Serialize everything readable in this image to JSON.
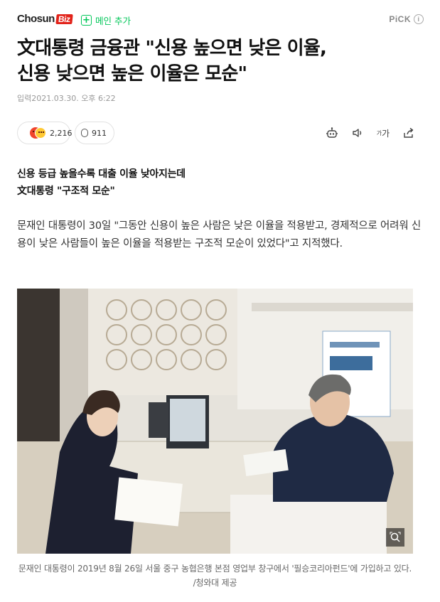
{
  "header": {
    "logo_text": "Chosun",
    "logo_badge": "Biz",
    "add_main_label": "메인 추가",
    "pick_label": "PiCK",
    "info_symbol": "i"
  },
  "article": {
    "title_line1": "文대통령 금융관 \"신용 높으면 낮은 이율,",
    "title_line2": "신용 낮으면 높은 이율은 모순\"",
    "datetime": "입력2021.03.30. 오후 6:22",
    "reaction_count": "2,216",
    "comment_count": "911",
    "subhead_line1": "신용 등급 높을수록 대출 이율 낮아지는데",
    "subhead_line2": "文대통령 \"구조적 모순\"",
    "body": "문재인 대통령이 30일 \"그동안 신용이 높은 사람은 낮은 이율을 적용받고, 경제적으로 어려워 신용이 낮은 사람들이 높은 이율을 적용받는 구조적 모순이 있었다\"고 지적했다.",
    "caption": "문재인 대통령이 2019년 8월 26일 서울 중구 농협은행 본점 영업부 창구에서 '필승코리아펀드'에 가입하고 있다. /청와대 제공"
  },
  "tools": {
    "font_size_label": "가"
  },
  "colors": {
    "accent_green": "#03c75a",
    "brand_red": "#e2231a",
    "reaction_angry": "#f0442c",
    "reaction_wow": "#ffc933"
  },
  "icons": [
    "add-icon",
    "info-icon",
    "reaction-icon",
    "comment-icon",
    "robot-summary-icon",
    "audio-icon",
    "font-size-icon",
    "share-icon",
    "zoom-icon"
  ]
}
